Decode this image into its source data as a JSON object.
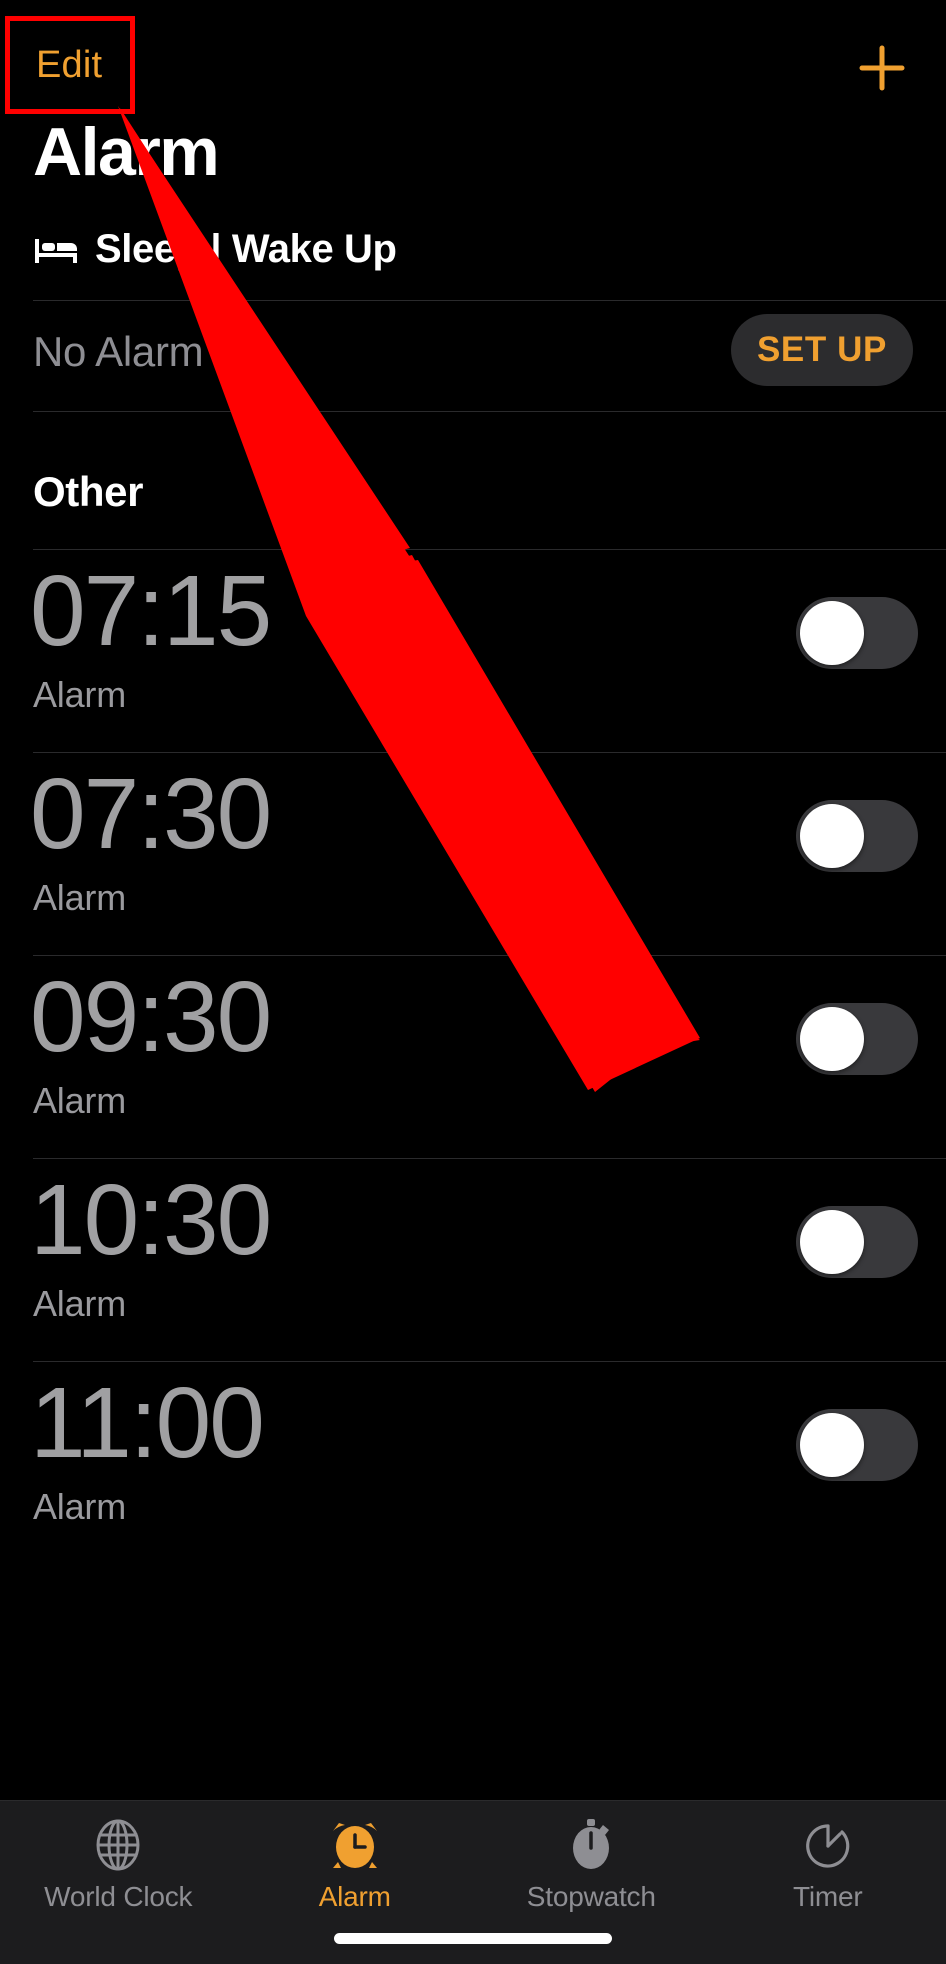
{
  "header": {
    "edit_label": "Edit",
    "add_icon": "plus-icon",
    "title": "Alarm"
  },
  "sleep_section": {
    "icon": "bed-icon",
    "heading": "Sleep | Wake Up",
    "status_text": "No Alarm",
    "setup_label": "SET UP"
  },
  "other_section": {
    "heading": "Other",
    "alarms": [
      {
        "time": "07:15",
        "label": "Alarm",
        "enabled": false
      },
      {
        "time": "07:30",
        "label": "Alarm",
        "enabled": false
      },
      {
        "time": "09:30",
        "label": "Alarm",
        "enabled": false
      },
      {
        "time": "10:30",
        "label": "Alarm",
        "enabled": false
      },
      {
        "time": "11:00",
        "label": "Alarm",
        "enabled": false
      }
    ]
  },
  "tabbar": {
    "tabs": [
      {
        "label": "World Clock",
        "icon": "globe-icon",
        "active": false
      },
      {
        "label": "Alarm",
        "icon": "alarm-clock-icon",
        "active": true
      },
      {
        "label": "Stopwatch",
        "icon": "stopwatch-icon",
        "active": false
      },
      {
        "label": "Timer",
        "icon": "timer-icon",
        "active": false
      }
    ]
  },
  "annotation": {
    "highlight_target": "Edit",
    "box_color": "#ff0000",
    "arrow_color": "#ff0000"
  },
  "colors": {
    "background": "#000000",
    "accent_orange": "#f0a030",
    "time_gray": "#a0a0a2",
    "secondary_gray": "#8e8e93",
    "toggle_track_off": "#39393c",
    "tabbar_bg": "#1c1c1e",
    "divider": "#2a2a2c"
  }
}
